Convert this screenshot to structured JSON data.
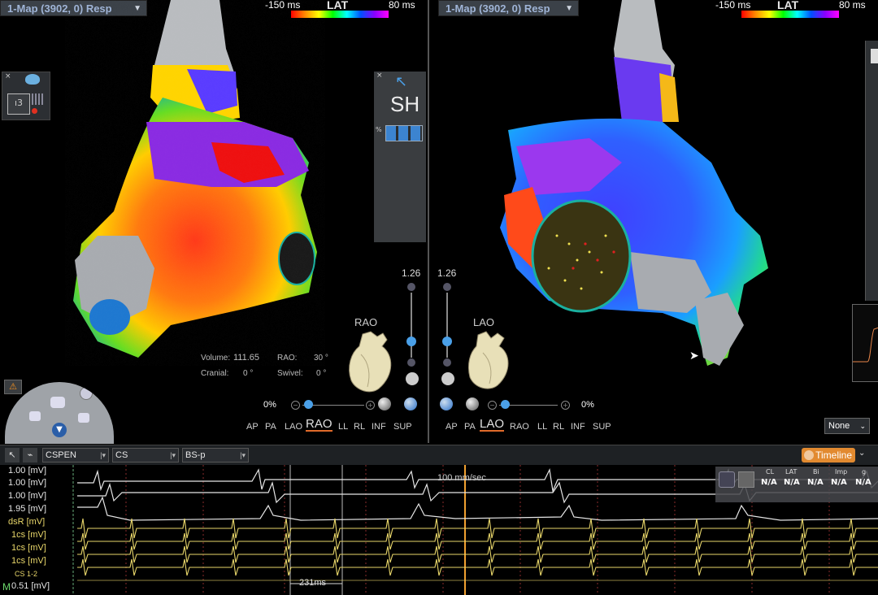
{
  "left_panel": {
    "map_dropdown": "1-Map (3902, 0) Resp",
    "lat_min": "-150 ms",
    "lat_title": "LAT",
    "lat_max": "80 ms",
    "volume_label": "Volume:",
    "volume_value": "111.65",
    "rao_label": "RAO:",
    "rao_value": "30 °",
    "cranial_label": "Cranial:",
    "cranial_value": "0 °",
    "swivel_label": "Swivel:",
    "swivel_value": "0 °",
    "orientation": "RAO",
    "zoom": "1.26",
    "opacity": "0%",
    "views": [
      "AP",
      "PA",
      "LAO",
      "RAO",
      "LL",
      "RL",
      "INF",
      "SUP"
    ],
    "active_view": "RAO"
  },
  "sh_panel": {
    "title": "SH",
    "percent": "%"
  },
  "right_panel": {
    "map_dropdown": "1-Map (3902, 0) Resp",
    "lat_min": "-150 ms",
    "lat_title": "LAT",
    "lat_max": "80 ms",
    "orientation": "LAO",
    "zoom": "1.26",
    "opacity": "0%",
    "views": [
      "AP",
      "PA",
      "LAO",
      "RAO",
      "LL",
      "RL",
      "INF",
      "SUP"
    ],
    "active_view": "LAO",
    "none_dropdown": "None"
  },
  "ecg_toolbar": {
    "select1": "CSPEN",
    "select2": "CS",
    "select3": "BS-p",
    "timeline_button": "Timeline"
  },
  "ecg": {
    "speed": "100 mm/sec",
    "measurement": "231ms",
    "channel_labels": [
      "1.00 [mV]",
      "1.00 [mV]",
      "1.00 [mV]",
      "1.95 [mV]",
      "dsR [mV]",
      "1cs [mV]",
      "1cs [mV]",
      "1cs [mV]",
      "CS 1-2",
      "0.51 [mV]"
    ],
    "marker_m": "M",
    "status_headers": [
      "CL",
      "LAT",
      "Bi",
      "Imp",
      "g"
    ],
    "status_values": [
      "N/A",
      "N/A",
      "N/A",
      "N/A",
      "N/A"
    ]
  },
  "colors": {
    "accent": "#e06a2a",
    "lat_gradient": "red-to-magenta",
    "ecg_white": "#e6e6e6",
    "ecg_yellow": "#e8d66a"
  }
}
